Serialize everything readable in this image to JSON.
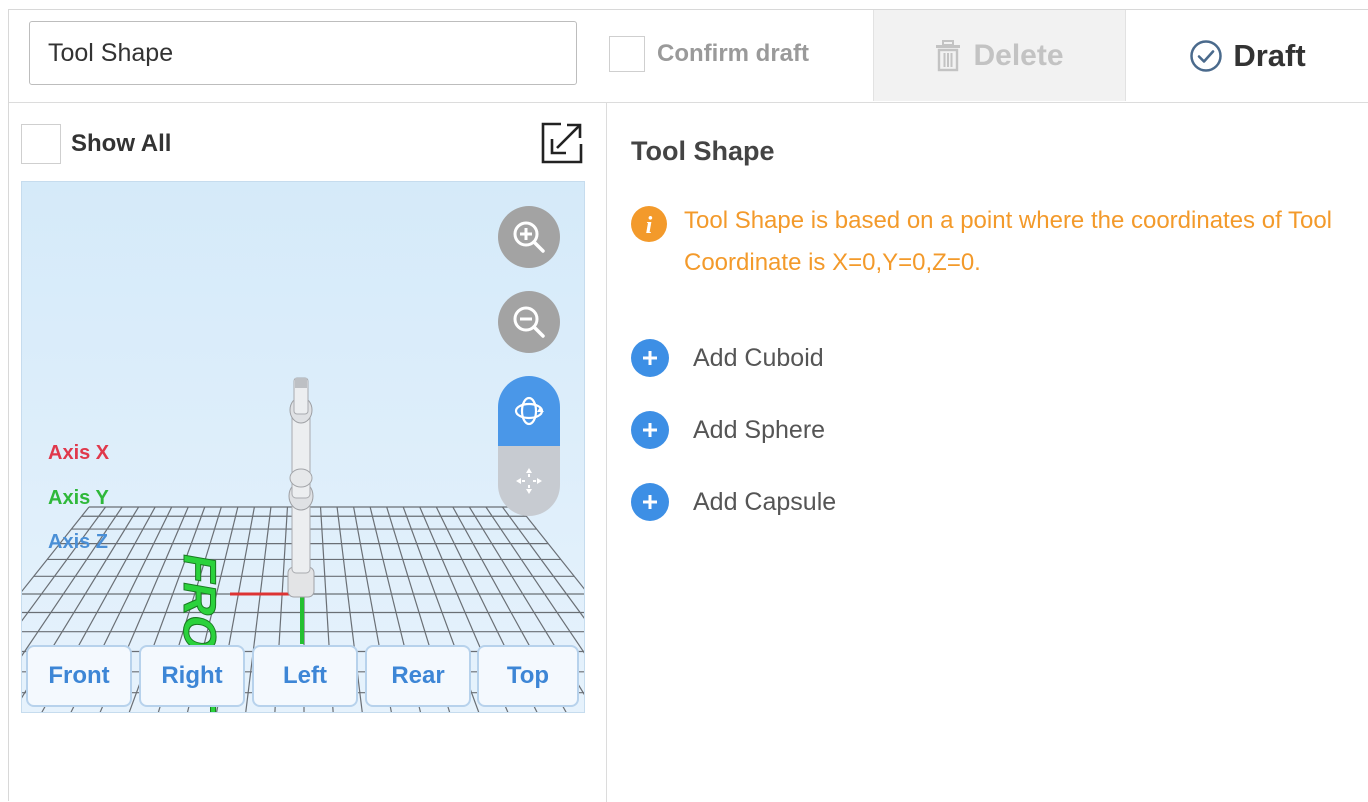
{
  "header": {
    "name_value": "Tool Shape",
    "confirm_label": "Confirm draft",
    "delete_label": "Delete",
    "draft_label": "Draft"
  },
  "left": {
    "show_all_label": "Show All",
    "axis_labels": {
      "x": "Axis X",
      "y": "Axis Y",
      "z": "Axis Z"
    },
    "floor_text": "FRONT",
    "view_buttons": [
      "Front",
      "Right",
      "Left",
      "Rear",
      "Top"
    ],
    "icons": [
      "expand-icon",
      "zoom-in-icon",
      "zoom-out-icon",
      "rotate-icon",
      "pan-icon"
    ]
  },
  "right": {
    "title": "Tool Shape",
    "info": "Tool Shape is based on a point where the coordinates of Tool Coordinate is X=0,Y=0,Z=0.",
    "add_items": [
      "Add Cuboid",
      "Add Sphere",
      "Add Capsule"
    ]
  },
  "colors": {
    "accent": "#3d8fe5",
    "warning": "#f39a2b",
    "axis_x": "#e0384b",
    "axis_y": "#2fb83a",
    "axis_z": "#4a8fd6",
    "disabled": "#c3c3c3"
  }
}
